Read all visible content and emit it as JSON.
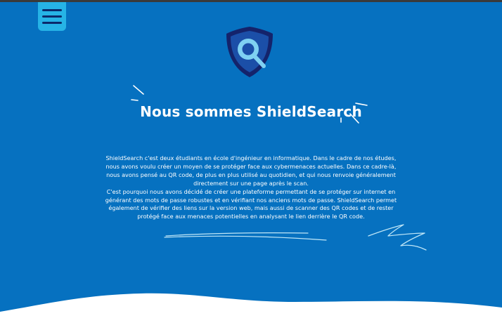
{
  "header": {
    "menu_icon": "hamburger-menu-icon"
  },
  "logo": {
    "icon": "shield-search-icon",
    "colors": {
      "shield_outer": "#14236b",
      "shield_inner": "#1b4fa8",
      "lens": "#7fd1f2"
    }
  },
  "hero": {
    "title": "Nous sommes ShieldSearch"
  },
  "about": {
    "paragraph_1": "ShieldSearch c'est deux étudiants en école d'ingénieur en informatique. Dans le cadre de nos études, nous avons voulu créer un moyen de se protéger face aux cybermenaces actuelles. Dans ce cadre-là, nous avons pensé au QR code, de plus en plus utilisé au quotidien, et qui nous renvoie généralement directement sur une page après le scan.",
    "paragraph_2": "C'est pourquoi nous avons décidé de créer une plateforme permettant de se protéger sur internet en générant des mots de passe robustes et en vérifiant nos anciens mots de passe. ShieldSearch permet également de vérifier des liens sur la version web, mais aussi de scanner des QR codes et de rester protégé face aux menaces potentielles en analysant le lien derrière le QR code."
  },
  "colors": {
    "background": "#0671c0",
    "accent": "#26b3e6",
    "text": "#ffffff",
    "wave": "#ffffff"
  }
}
